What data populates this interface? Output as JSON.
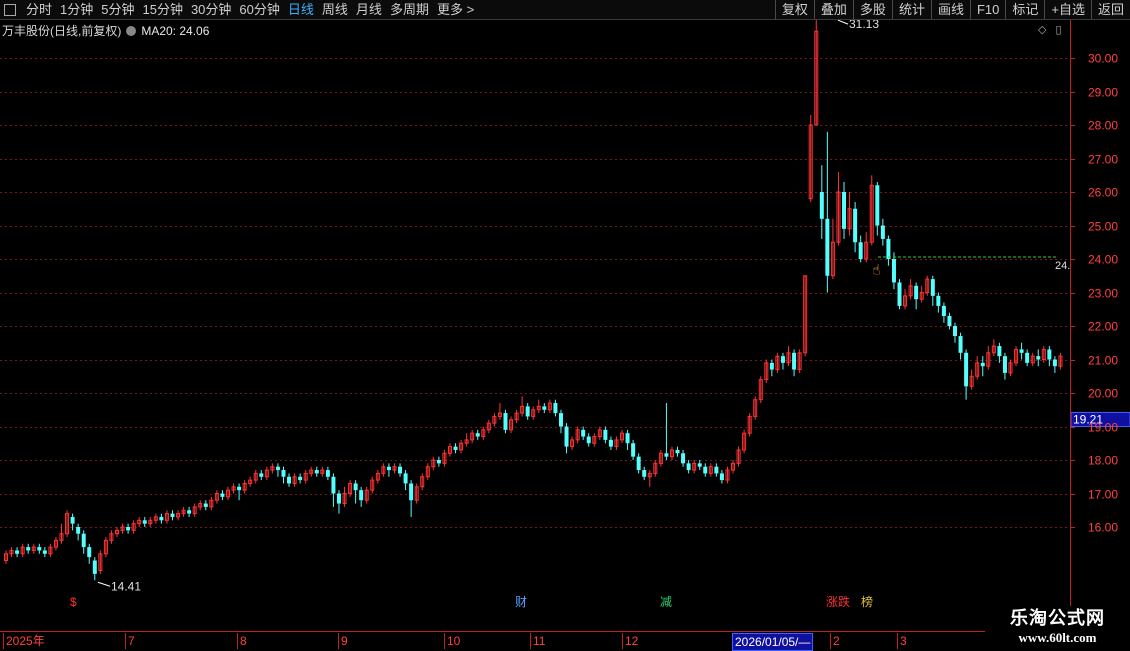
{
  "toolbar": {
    "periods": [
      "分时",
      "1分钟",
      "5分钟",
      "15分钟",
      "30分钟",
      "60分钟",
      "日线",
      "周线",
      "月线",
      "多周期",
      "更多 >"
    ],
    "active": "日线",
    "right_buttons": [
      "复权",
      "叠加",
      "多股",
      "统计",
      "画线",
      "F10",
      "标记",
      "+自选",
      "返回"
    ]
  },
  "info": {
    "stock": "万丰股份(日线,前复权)",
    "ma_label": "MA20: 24.06"
  },
  "price_axis": {
    "ticks": [
      "30.00",
      "29.00",
      "28.00",
      "27.00",
      "26.00",
      "25.00",
      "24.00",
      "23.00",
      "22.00",
      "21.00",
      "20.00",
      "19.00",
      "18.00",
      "17.00",
      "16.00"
    ],
    "current_price": "19.21",
    "right_label": "24."
  },
  "annotations": {
    "high": "31.13",
    "low": "14.41"
  },
  "markers": [
    {
      "text": "$",
      "color": "#ff3030"
    },
    {
      "text": "财",
      "color": "#5aa0ff"
    },
    {
      "text": "减",
      "color": "#30d070"
    },
    {
      "text": "涨跌",
      "color": "#ff3030"
    },
    {
      "text": "榜",
      "color": "#e0c030"
    }
  ],
  "date_axis": {
    "labels": [
      "2025年",
      "7",
      "8",
      "9",
      "10",
      "11",
      "12",
      "2026/01/05/—",
      "2",
      "3"
    ],
    "highlight": "2026/01/05/—"
  },
  "colors": {
    "up": "#ff3333",
    "down": "#54ffff",
    "grid": "#7a1818",
    "ma": "#2ecc40"
  },
  "chart_data": {
    "type": "candlestick",
    "ylim": [
      15.3,
      31.8
    ],
    "ma20_level": 24.06,
    "candles": [
      [
        15.0,
        15.2,
        14.9,
        15.3
      ],
      [
        15.2,
        15.3,
        15.1,
        15.4
      ],
      [
        15.3,
        15.2,
        15.1,
        15.4
      ],
      [
        15.2,
        15.4,
        15.1,
        15.5
      ],
      [
        15.4,
        15.3,
        15.2,
        15.5
      ],
      [
        15.3,
        15.4,
        15.2,
        15.5
      ],
      [
        15.4,
        15.3,
        15.2,
        15.5
      ],
      [
        15.3,
        15.2,
        15.1,
        15.4
      ],
      [
        15.2,
        15.4,
        15.1,
        15.5
      ],
      [
        15.4,
        15.6,
        15.3,
        15.7
      ],
      [
        15.6,
        15.8,
        15.5,
        16.1
      ],
      [
        15.8,
        16.4,
        15.7,
        16.5
      ],
      [
        16.3,
        16.1,
        15.9,
        16.4
      ],
      [
        16.0,
        15.8,
        15.6,
        16.1
      ],
      [
        15.8,
        15.4,
        15.2,
        15.9
      ],
      [
        15.4,
        15.1,
        14.9,
        15.5
      ],
      [
        15.0,
        14.6,
        14.41,
        15.1
      ],
      [
        14.7,
        15.2,
        14.6,
        15.3
      ],
      [
        15.2,
        15.6,
        15.1,
        15.7
      ],
      [
        15.6,
        15.8,
        15.5,
        15.9
      ],
      [
        15.8,
        15.9,
        15.7,
        16.0
      ],
      [
        15.9,
        16.0,
        15.8,
        16.1
      ],
      [
        16.0,
        15.9,
        15.8,
        16.1
      ],
      [
        15.9,
        16.1,
        15.8,
        16.2
      ],
      [
        16.1,
        16.2,
        16.0,
        16.3
      ],
      [
        16.2,
        16.1,
        16.0,
        16.3
      ],
      [
        16.1,
        16.2,
        16.0,
        16.3
      ],
      [
        16.2,
        16.3,
        16.1,
        16.4
      ],
      [
        16.3,
        16.2,
        16.1,
        16.4
      ],
      [
        16.2,
        16.4,
        16.1,
        16.5
      ],
      [
        16.4,
        16.3,
        16.2,
        16.5
      ],
      [
        16.3,
        16.4,
        16.2,
        16.5
      ],
      [
        16.4,
        16.5,
        16.3,
        16.6
      ],
      [
        16.5,
        16.4,
        16.3,
        16.6
      ],
      [
        16.4,
        16.6,
        16.3,
        16.7
      ],
      [
        16.6,
        16.7,
        16.5,
        16.8
      ],
      [
        16.7,
        16.6,
        16.5,
        16.8
      ],
      [
        16.6,
        16.8,
        16.5,
        16.9
      ],
      [
        16.8,
        17.0,
        16.7,
        17.1
      ],
      [
        17.0,
        16.9,
        16.8,
        17.1
      ],
      [
        16.9,
        17.1,
        16.8,
        17.2
      ],
      [
        17.1,
        17.2,
        17.0,
        17.3
      ],
      [
        17.2,
        17.1,
        16.8,
        17.3
      ],
      [
        17.1,
        17.3,
        17.0,
        17.4
      ],
      [
        17.3,
        17.4,
        17.2,
        17.5
      ],
      [
        17.4,
        17.6,
        17.3,
        17.7
      ],
      [
        17.6,
        17.5,
        17.4,
        17.7
      ],
      [
        17.5,
        17.7,
        17.4,
        17.8
      ],
      [
        17.7,
        17.8,
        17.6,
        17.9
      ],
      [
        17.8,
        17.7,
        17.5,
        17.9
      ],
      [
        17.7,
        17.5,
        17.3,
        17.8
      ],
      [
        17.5,
        17.3,
        17.2,
        17.6
      ],
      [
        17.3,
        17.5,
        17.2,
        17.6
      ],
      [
        17.5,
        17.4,
        17.3,
        17.6
      ],
      [
        17.4,
        17.6,
        17.3,
        17.7
      ],
      [
        17.6,
        17.7,
        17.5,
        17.8
      ],
      [
        17.7,
        17.6,
        17.5,
        17.8
      ],
      [
        17.6,
        17.7,
        17.5,
        17.8
      ],
      [
        17.7,
        17.5,
        17.4,
        17.8
      ],
      [
        17.5,
        17.0,
        16.6,
        17.6
      ],
      [
        17.0,
        16.7,
        16.4,
        17.1
      ],
      [
        16.7,
        17.0,
        16.6,
        17.2
      ],
      [
        17.0,
        17.3,
        16.9,
        17.4
      ],
      [
        17.3,
        17.1,
        16.7,
        17.4
      ],
      [
        17.1,
        16.8,
        16.6,
        17.2
      ],
      [
        16.8,
        17.1,
        16.7,
        17.2
      ],
      [
        17.1,
        17.4,
        17.0,
        17.5
      ],
      [
        17.4,
        17.6,
        17.3,
        17.7
      ],
      [
        17.6,
        17.8,
        17.5,
        17.9
      ],
      [
        17.8,
        17.7,
        17.5,
        17.9
      ],
      [
        17.7,
        17.8,
        17.6,
        17.9
      ],
      [
        17.8,
        17.6,
        17.5,
        17.9
      ],
      [
        17.6,
        17.3,
        17.1,
        17.7
      ],
      [
        17.3,
        16.8,
        16.3,
        17.4
      ],
      [
        16.8,
        17.2,
        16.7,
        17.3
      ],
      [
        17.2,
        17.5,
        17.1,
        17.6
      ],
      [
        17.5,
        17.8,
        17.4,
        17.9
      ],
      [
        17.8,
        18.0,
        17.7,
        18.1
      ],
      [
        18.0,
        17.9,
        17.8,
        18.1
      ],
      [
        17.9,
        18.2,
        17.8,
        18.3
      ],
      [
        18.2,
        18.4,
        18.1,
        18.5
      ],
      [
        18.4,
        18.3,
        18.2,
        18.5
      ],
      [
        18.3,
        18.5,
        18.2,
        18.6
      ],
      [
        18.5,
        18.6,
        18.4,
        18.8
      ],
      [
        18.6,
        18.8,
        18.5,
        18.9
      ],
      [
        18.8,
        18.7,
        18.6,
        18.9
      ],
      [
        18.7,
        18.9,
        18.6,
        19.0
      ],
      [
        18.9,
        19.1,
        18.8,
        19.2
      ],
      [
        19.1,
        19.3,
        19.0,
        19.4
      ],
      [
        19.3,
        19.4,
        19.2,
        19.7
      ],
      [
        19.4,
        18.9,
        18.8,
        19.5
      ],
      [
        18.9,
        19.2,
        18.8,
        19.3
      ],
      [
        19.2,
        19.4,
        19.1,
        19.5
      ],
      [
        19.4,
        19.6,
        19.3,
        19.9
      ],
      [
        19.6,
        19.3,
        19.2,
        19.7
      ],
      [
        19.3,
        19.5,
        19.2,
        19.6
      ],
      [
        19.5,
        19.6,
        19.4,
        19.8
      ],
      [
        19.6,
        19.5,
        19.4,
        19.7
      ],
      [
        19.5,
        19.7,
        19.4,
        19.8
      ],
      [
        19.7,
        19.4,
        19.3,
        19.8
      ],
      [
        19.4,
        19.0,
        18.8,
        19.5
      ],
      [
        19.0,
        18.4,
        18.2,
        19.1
      ],
      [
        18.4,
        18.6,
        18.3,
        18.7
      ],
      [
        18.6,
        18.9,
        18.5,
        19.0
      ],
      [
        18.9,
        18.7,
        18.6,
        19.0
      ],
      [
        18.7,
        18.5,
        18.4,
        18.8
      ],
      [
        18.5,
        18.7,
        18.4,
        18.8
      ],
      [
        18.7,
        18.9,
        18.6,
        19.0
      ],
      [
        18.9,
        18.6,
        18.5,
        19.0
      ],
      [
        18.6,
        18.4,
        18.3,
        18.7
      ],
      [
        18.4,
        18.6,
        18.3,
        18.7
      ],
      [
        18.6,
        18.8,
        18.5,
        18.9
      ],
      [
        18.8,
        18.5,
        18.3,
        18.9
      ],
      [
        18.5,
        18.1,
        18.0,
        18.6
      ],
      [
        18.1,
        17.7,
        17.6,
        18.2
      ],
      [
        17.7,
        17.5,
        17.4,
        17.8
      ],
      [
        17.5,
        17.6,
        17.2,
        17.7
      ],
      [
        17.6,
        17.9,
        17.5,
        18.0
      ],
      [
        17.9,
        18.2,
        17.8,
        18.3
      ],
      [
        18.2,
        18.1,
        18.0,
        19.7
      ],
      [
        18.1,
        18.3,
        18.0,
        18.4
      ],
      [
        18.3,
        18.2,
        18.1,
        18.4
      ],
      [
        18.2,
        17.9,
        17.8,
        18.3
      ],
      [
        17.9,
        17.7,
        17.6,
        18.0
      ],
      [
        17.7,
        17.9,
        17.6,
        18.0
      ],
      [
        17.9,
        17.8,
        17.7,
        18.0
      ],
      [
        17.8,
        17.6,
        17.5,
        17.9
      ],
      [
        17.6,
        17.8,
        17.5,
        17.9
      ],
      [
        17.8,
        17.6,
        17.5,
        17.9
      ],
      [
        17.6,
        17.4,
        17.3,
        17.7
      ],
      [
        17.4,
        17.7,
        17.3,
        17.8
      ],
      [
        17.7,
        17.9,
        17.6,
        18.0
      ],
      [
        17.9,
        18.3,
        17.8,
        18.4
      ],
      [
        18.3,
        18.8,
        18.2,
        18.9
      ],
      [
        18.8,
        19.3,
        18.7,
        19.4
      ],
      [
        19.3,
        19.8,
        19.2,
        19.9
      ],
      [
        19.8,
        20.4,
        19.7,
        20.5
      ],
      [
        20.4,
        20.9,
        20.3,
        21.0
      ],
      [
        20.9,
        20.7,
        20.5,
        21.0
      ],
      [
        20.7,
        21.1,
        20.6,
        21.2
      ],
      [
        21.1,
        20.9,
        20.7,
        21.2
      ],
      [
        20.9,
        21.2,
        20.8,
        21.4
      ],
      [
        21.2,
        20.7,
        20.5,
        21.3
      ],
      [
        20.7,
        21.2,
        20.6,
        21.3
      ],
      [
        21.2,
        23.5,
        21.1,
        23.5
      ],
      [
        25.8,
        28.0,
        25.7,
        28.3
      ],
      [
        28.0,
        30.8,
        28.0,
        31.13
      ],
      [
        26.0,
        25.2,
        24.6,
        26.8
      ],
      [
        25.2,
        23.5,
        23.0,
        27.8
      ],
      [
        23.5,
        24.5,
        23.4,
        25.2
      ],
      [
        24.5,
        26.0,
        24.4,
        26.6
      ],
      [
        26.0,
        24.9,
        24.6,
        26.3
      ],
      [
        24.9,
        25.5,
        24.7,
        26.0
      ],
      [
        25.5,
        24.5,
        24.2,
        25.7
      ],
      [
        24.5,
        24.0,
        23.9,
        24.7
      ],
      [
        24.0,
        24.5,
        23.9,
        24.8
      ],
      [
        24.5,
        26.2,
        24.4,
        26.5
      ],
      [
        26.2,
        25.0,
        24.7,
        26.3
      ],
      [
        25.0,
        24.6,
        24.4,
        25.2
      ],
      [
        24.6,
        24.0,
        23.8,
        24.7
      ],
      [
        24.0,
        23.3,
        23.1,
        24.2
      ],
      [
        23.3,
        22.6,
        22.5,
        23.4
      ],
      [
        22.6,
        22.9,
        22.5,
        23.1
      ],
      [
        22.9,
        23.2,
        22.8,
        23.4
      ],
      [
        23.2,
        22.8,
        22.5,
        23.3
      ],
      [
        22.8,
        23.0,
        22.7,
        23.2
      ],
      [
        23.0,
        23.4,
        22.9,
        23.5
      ],
      [
        23.4,
        22.9,
        22.6,
        23.5
      ],
      [
        22.9,
        22.6,
        22.4,
        23.0
      ],
      [
        22.6,
        22.3,
        22.1,
        22.7
      ],
      [
        22.3,
        22.0,
        21.9,
        22.4
      ],
      [
        22.0,
        21.7,
        21.5,
        22.1
      ],
      [
        21.7,
        21.2,
        21.0,
        21.8
      ],
      [
        21.2,
        20.2,
        19.8,
        21.3
      ],
      [
        20.2,
        20.5,
        20.1,
        20.7
      ],
      [
        20.5,
        20.9,
        20.4,
        21.1
      ],
      [
        20.9,
        20.8,
        20.5,
        21.1
      ],
      [
        20.8,
        21.2,
        20.7,
        21.4
      ],
      [
        21.2,
        21.4,
        21.1,
        21.6
      ],
      [
        21.4,
        21.1,
        20.9,
        21.5
      ],
      [
        21.1,
        20.6,
        20.4,
        21.2
      ],
      [
        20.6,
        20.9,
        20.5,
        21.0
      ],
      [
        20.9,
        21.3,
        20.8,
        21.4
      ],
      [
        21.3,
        21.2,
        21.0,
        21.5
      ],
      [
        21.2,
        20.9,
        20.8,
        21.3
      ],
      [
        20.9,
        21.1,
        20.8,
        21.2
      ],
      [
        21.1,
        21.0,
        20.8,
        21.3
      ],
      [
        21.0,
        21.3,
        20.9,
        21.4
      ],
      [
        21.3,
        21.0,
        20.8,
        21.4
      ],
      [
        21.0,
        20.8,
        20.6,
        21.1
      ],
      [
        20.8,
        21.1,
        20.7,
        21.2
      ]
    ]
  }
}
